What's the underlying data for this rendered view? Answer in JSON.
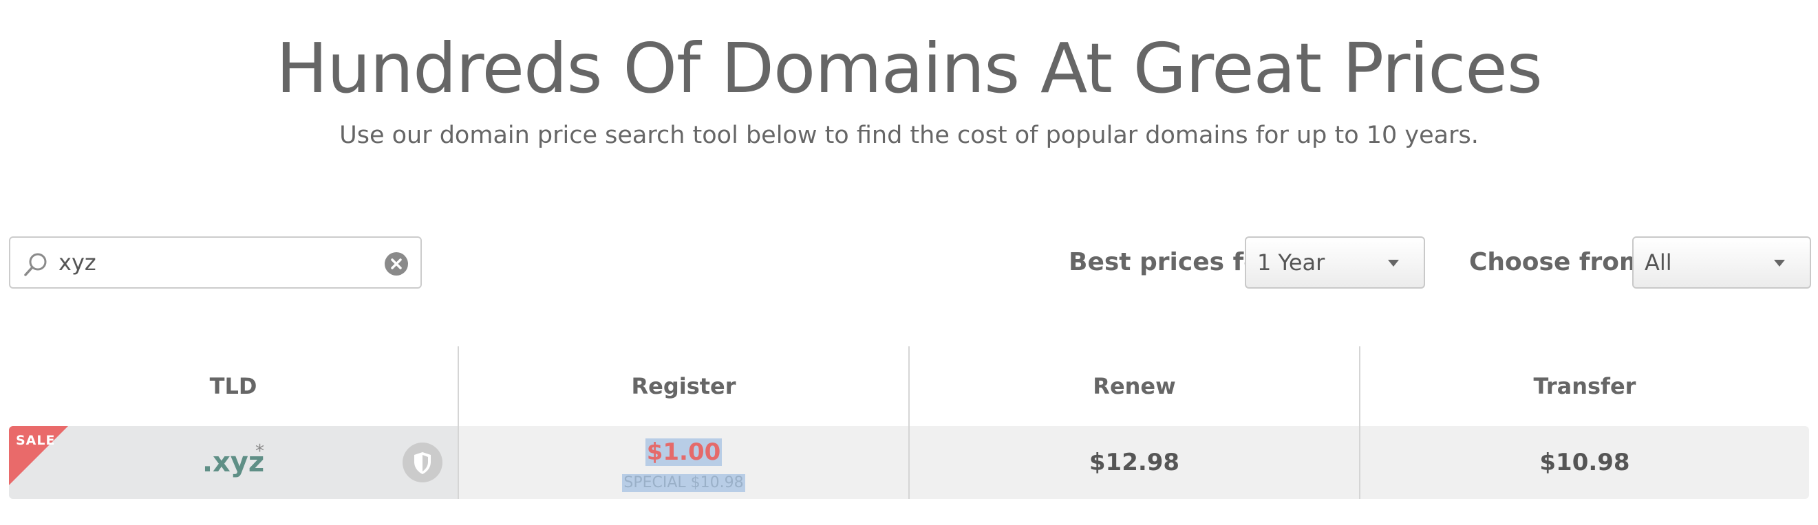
{
  "hero": {
    "title": "Hundreds Of Domains At Great Prices",
    "subtitle": "Use our domain price search tool below to find the cost of popular domains for up to 10 years."
  },
  "search": {
    "value": "xyz",
    "icon": "search-icon",
    "clear_icon": "close-circle-icon"
  },
  "filters": {
    "best_prices_label": "Best prices for",
    "best_prices_value": "1 Year",
    "choose_from_label": "Choose from",
    "choose_from_value": "All"
  },
  "table": {
    "headers": [
      "TLD",
      "Register",
      "Renew",
      "Transfer"
    ],
    "rows": [
      {
        "badge": "SALE",
        "tld": ".xyz",
        "tld_marker": "*",
        "register_price": "$1.00",
        "register_special": "SPECIAL $10.98",
        "renew_price": "$12.98",
        "transfer_price": "$10.98"
      }
    ]
  },
  "colors": {
    "text": "#666666",
    "sale_flag": "#e96a6a",
    "tld_text": "#5f8f86",
    "sale_price": "#e56a6a",
    "highlight": "#b8cde6"
  }
}
